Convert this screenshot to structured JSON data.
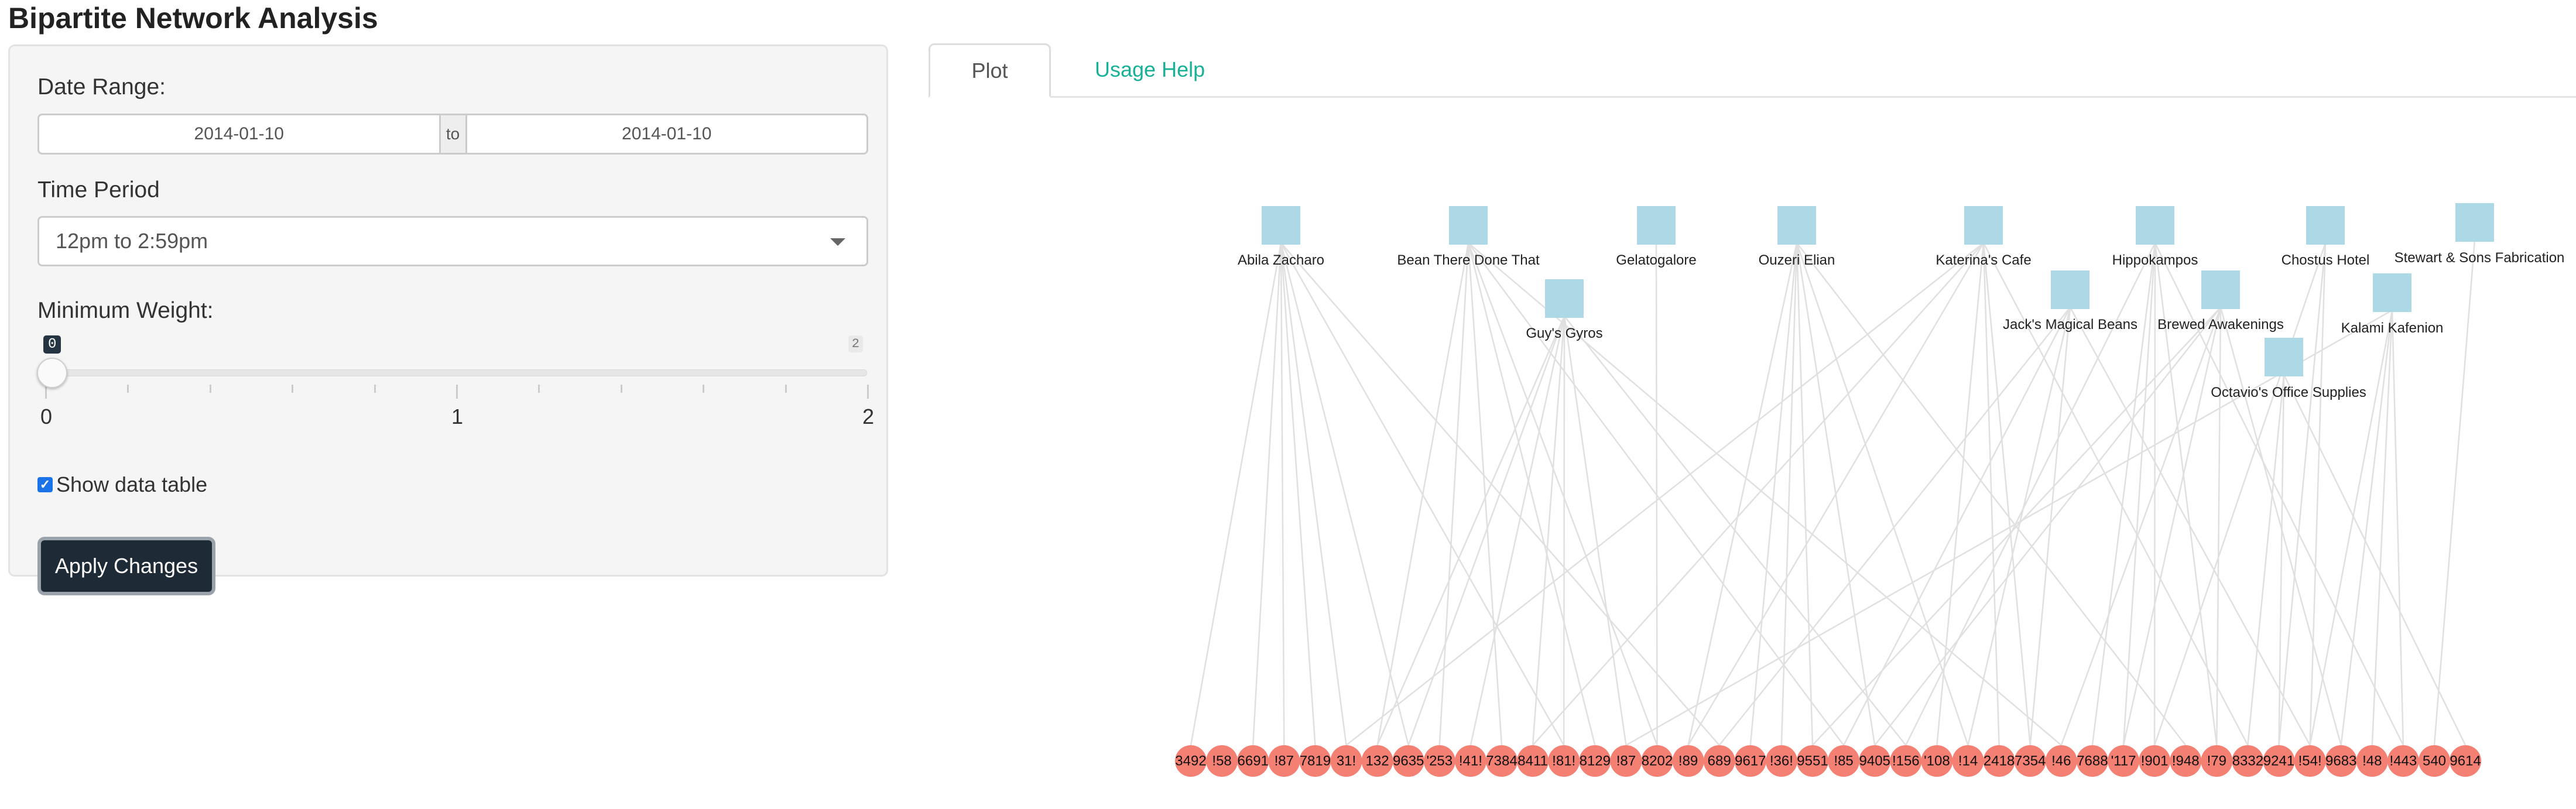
{
  "app": {
    "title": "Bipartite Network Analysis"
  },
  "sidebar": {
    "date_range": {
      "label": "Date Range:",
      "start": "2014-01-10",
      "separator": "to",
      "end": "2014-01-10"
    },
    "time_period": {
      "label": "Time Period",
      "selected": "12pm to 2:59pm"
    },
    "min_weight": {
      "label": "Minimum Weight:",
      "value": "0",
      "max_badge": "2",
      "tick_labels": [
        "0",
        "1",
        "2"
      ],
      "value_fraction": 0
    },
    "show_table": {
      "label": "Show data table",
      "checked": true
    },
    "apply_button": "Apply Changes"
  },
  "tabs": [
    {
      "label": "Plot",
      "active": true
    },
    {
      "label": "Usage Help",
      "active": false
    }
  ],
  "colors": {
    "shop_node": "#add8e6",
    "card_node": "#f47f73",
    "edge": "#e0e0e0",
    "accent": "#18b197",
    "button": "#1e2a36"
  },
  "network": {
    "shops": [
      "Abila Zacharo",
      "Bean There Done That",
      "Gelatogalore",
      "Ouzeri Elian",
      "Katerina's Cafe",
      "Hippokampos",
      "Chostus Hotel",
      "Stewart & Sons Fabrication",
      "Guy's Gyros",
      "Jack's Magical Beans",
      "Brewed Awakenings",
      "Kalami Kafenion",
      "Octavio's Office Supplies"
    ],
    "cards": [
      "3492",
      "!58",
      "6691",
      "!87",
      "7819",
      "31!",
      "132",
      "9635",
      "'253",
      "!41!",
      "7384",
      "8411",
      "!81!",
      "8129",
      "!87",
      "8202",
      "!89",
      "689",
      "9617",
      "!36!",
      "9551",
      "!85",
      "9405",
      "!156",
      "'108",
      "!14",
      "2418",
      "7354",
      "!46",
      "7688",
      "'117",
      "!901",
      "!948",
      "!79",
      "8332",
      "9241",
      "!54!",
      "9683",
      "!48",
      "!443",
      "540",
      "9614"
    ],
    "edges": [
      [
        0,
        0
      ],
      [
        0,
        2
      ],
      [
        0,
        3
      ],
      [
        0,
        4
      ],
      [
        0,
        5
      ],
      [
        0,
        7
      ],
      [
        0,
        12
      ],
      [
        0,
        17
      ],
      [
        1,
        6
      ],
      [
        1,
        8
      ],
      [
        1,
        10
      ],
      [
        1,
        13
      ],
      [
        1,
        15
      ],
      [
        1,
        21
      ],
      [
        1,
        28
      ],
      [
        2,
        15
      ],
      [
        3,
        16
      ],
      [
        3,
        18
      ],
      [
        3,
        19
      ],
      [
        3,
        20
      ],
      [
        3,
        22
      ],
      [
        3,
        25
      ],
      [
        3,
        32
      ],
      [
        4,
        5
      ],
      [
        4,
        11
      ],
      [
        4,
        16
      ],
      [
        4,
        24
      ],
      [
        4,
        26
      ],
      [
        4,
        27
      ],
      [
        4,
        34
      ],
      [
        5,
        29
      ],
      [
        5,
        30
      ],
      [
        5,
        31
      ],
      [
        5,
        33
      ],
      [
        5,
        39
      ],
      [
        5,
        23
      ],
      [
        6,
        35
      ],
      [
        6,
        36
      ],
      [
        6,
        31
      ],
      [
        7,
        40
      ],
      [
        8,
        6
      ],
      [
        8,
        7
      ],
      [
        8,
        9
      ],
      [
        8,
        11
      ],
      [
        8,
        12
      ],
      [
        8,
        14
      ],
      [
        8,
        23
      ],
      [
        9,
        17
      ],
      [
        9,
        21
      ],
      [
        9,
        25
      ],
      [
        9,
        27
      ],
      [
        9,
        36
      ],
      [
        10,
        22
      ],
      [
        10,
        28
      ],
      [
        10,
        30
      ],
      [
        10,
        33
      ],
      [
        10,
        37
      ],
      [
        10,
        20
      ],
      [
        11,
        36
      ],
      [
        11,
        37
      ],
      [
        11,
        38
      ],
      [
        11,
        39
      ],
      [
        11,
        14
      ],
      [
        12,
        34
      ],
      [
        12,
        35
      ],
      [
        12,
        41
      ]
    ]
  }
}
